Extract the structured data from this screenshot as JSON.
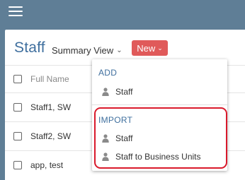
{
  "topbar": {
    "menu_icon": "hamburger-icon"
  },
  "header": {
    "title": "Staff",
    "view_select": "Summary View",
    "new_button": "New"
  },
  "table": {
    "column_header": "Full Name",
    "rows": [
      {
        "name": "Staff1, SW"
      },
      {
        "name": "Staff2, SW"
      },
      {
        "name": "app, test"
      }
    ]
  },
  "dropdown": {
    "add_section": {
      "heading": "ADD",
      "items": [
        {
          "label": "Staff",
          "icon": "person-icon"
        }
      ]
    },
    "import_section": {
      "heading": "IMPORT",
      "items": [
        {
          "label": "Staff",
          "icon": "person-icon"
        },
        {
          "label": "Staff to Business Units",
          "icon": "person-icon"
        }
      ]
    }
  },
  "colors": {
    "topbar": "#5f7e96",
    "accent_blue": "#3f6f9e",
    "new_button": "#e05a5a",
    "highlight": "#d9192b"
  }
}
